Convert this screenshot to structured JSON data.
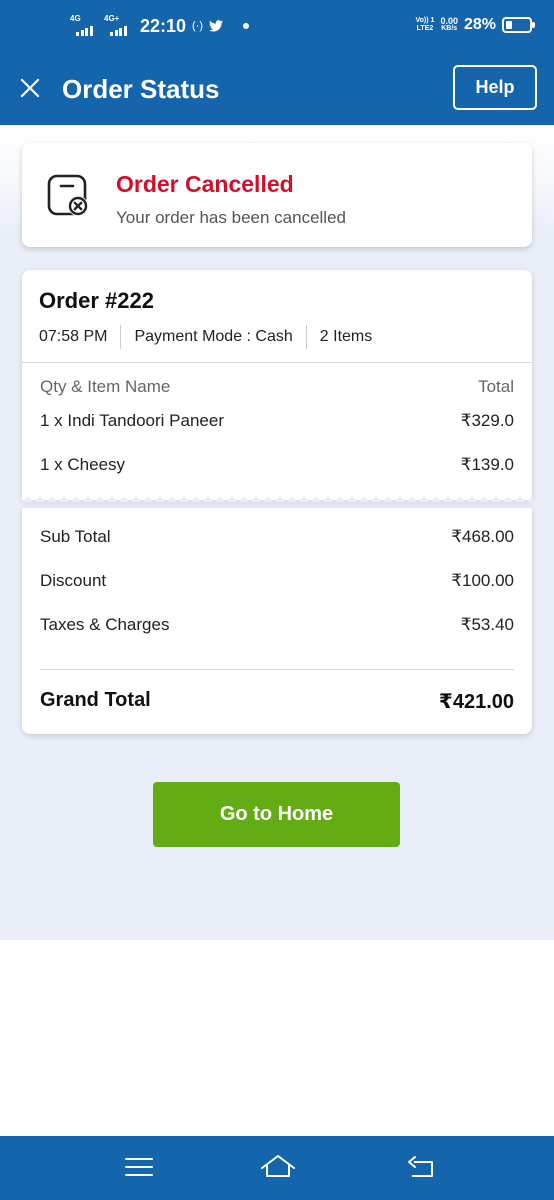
{
  "status_bar": {
    "network1": "4G",
    "network2": "4G+",
    "time": "22:10",
    "volte": "Vo))",
    "lte": "LTE2",
    "sim": "1",
    "speed": "0.00",
    "speed_unit": "KB/s",
    "battery": "28%",
    "battery_level": 0.28
  },
  "app_bar": {
    "title": "Order Status",
    "help_label": "Help"
  },
  "status_card": {
    "title": "Order Cancelled",
    "subtitle": "Your order has been cancelled",
    "title_color": "#d0102a"
  },
  "order": {
    "number": "Order #222",
    "time": "07:58 PM",
    "payment_mode": "Payment Mode : Cash",
    "item_count": "2 Items",
    "columns": {
      "name": "Qty & Item Name",
      "total": "Total"
    },
    "items": [
      {
        "name": "1 x Indi Tandoori Paneer",
        "price": "₹329.0"
      },
      {
        "name": "1 x Cheesy",
        "price": "₹139.0"
      }
    ]
  },
  "totals": {
    "rows": [
      {
        "label": "Sub Total",
        "value": "₹468.00"
      },
      {
        "label": "Discount",
        "value": "₹100.00"
      },
      {
        "label": "Taxes & Charges",
        "value": "₹53.40"
      }
    ],
    "grand_label": "Grand Total",
    "grand_value": "₹421.00"
  },
  "home_button": {
    "label": "Go to Home",
    "color": "#64ac14"
  },
  "theme": {
    "primary": "#1565ad"
  },
  "icons": {
    "close": "close-icon",
    "status": "order-cancelled-icon",
    "nav_menu": "menu-icon",
    "nav_home": "home-icon",
    "nav_back": "back-icon"
  }
}
